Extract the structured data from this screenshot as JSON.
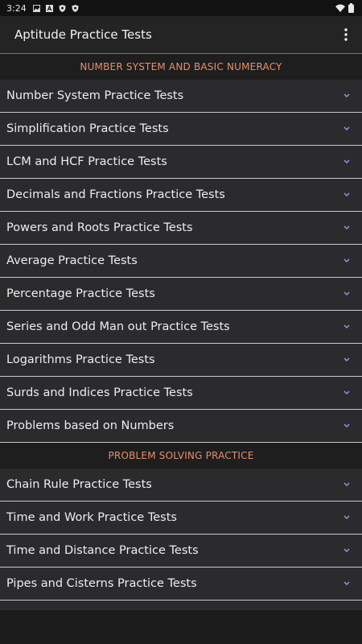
{
  "status": {
    "time": "3:24"
  },
  "app": {
    "title": "Aptitude Practice Tests"
  },
  "sections": [
    {
      "title": "NUMBER SYSTEM AND BASIC NUMERACY",
      "items": [
        "Number System Practice Tests",
        "Simplification Practice Tests",
        "LCM and HCF Practice Tests",
        "Decimals and Fractions Practice Tests",
        "Powers and Roots Practice Tests",
        "Average Practice Tests",
        "Percentage Practice Tests",
        "Series and Odd Man out Practice Tests",
        "Logarithms Practice Tests",
        "Surds and Indices Practice Tests",
        "Problems based on Numbers"
      ]
    },
    {
      "title": "PROBLEM SOLVING PRACTICE",
      "items": [
        "Chain Rule Practice Tests",
        "Time and Work Practice Tests",
        "Time and Distance Practice Tests",
        "Pipes and Cisterns Practice Tests"
      ]
    }
  ],
  "colors": {
    "accent": "#e4906a",
    "chevron": "#8a9fe8"
  },
  "icons": [
    "photo-icon",
    "a-icon",
    "shield-icon",
    "shield-icon",
    "wifi-icon",
    "battery-icon",
    "more-vert-icon",
    "chevron-down-icon"
  ]
}
